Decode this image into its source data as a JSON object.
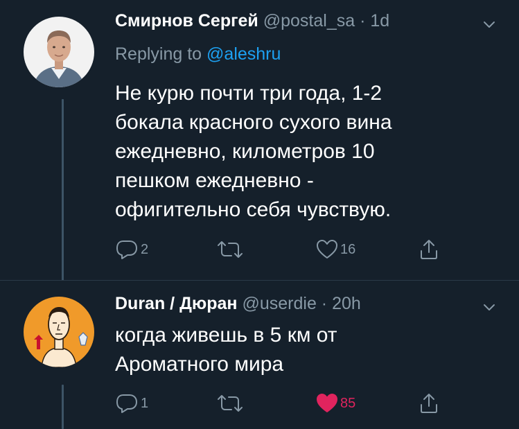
{
  "tweets": [
    {
      "name": "Смирнов Сергей",
      "handle": "@postal_sa",
      "separator": "·",
      "time": "1d",
      "replying_label": "Replying to",
      "replying_to": "@aleshru",
      "text": "Не курю почти три года, 1-2\nбокала красного сухого вина\nежедневно, километров 10\nпешком ежедневно -\nофигительно себя чувствую.",
      "replies": "2",
      "retweets": "",
      "likes": "16",
      "liked": false
    },
    {
      "name": "Duran / Дюран",
      "handle": "@userdie",
      "separator": "·",
      "time": "20h",
      "text": "когда живешь в 5 км от\nАроматного мира",
      "replies": "1",
      "retweets": "",
      "likes": "85",
      "liked": true
    }
  ],
  "icons": {
    "reply": "reply-icon",
    "retweet": "retweet-icon",
    "like": "heart-icon",
    "share": "share-icon",
    "menu": "chevron-down-icon"
  },
  "colors": {
    "background": "#15202b",
    "secondary_text": "#8899a6",
    "link": "#1da1f2",
    "like_active": "#e0245e"
  }
}
